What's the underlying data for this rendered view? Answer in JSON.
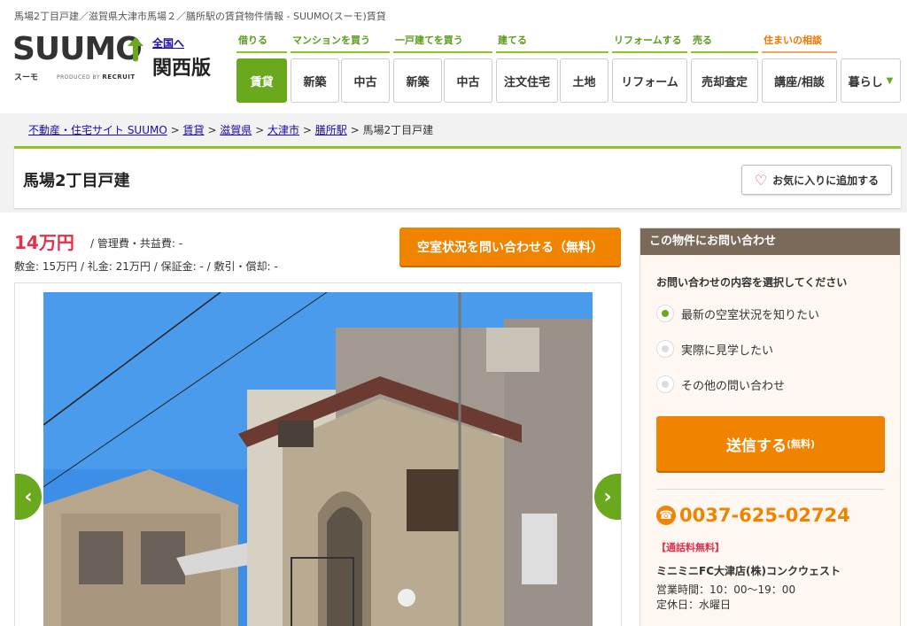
{
  "page_caption": "馬場2丁目戸建／滋賀県大津市馬場２／膳所駅の賃貸物件情報 - SUUMO(スーモ)賃貸",
  "logo": {
    "word": "SUUMO",
    "sub": "スーモ",
    "produced": "PRODUCED BY",
    "recruit": "RECRUIT"
  },
  "region": {
    "link": "全国へ",
    "name": "関西版"
  },
  "nav": {
    "groups": [
      {
        "category": "借りる",
        "buttons": [
          "賃貸"
        ]
      },
      {
        "category": "マンションを買う",
        "buttons": [
          "新築",
          "中古"
        ]
      },
      {
        "category": "一戸建てを買う",
        "buttons": [
          "新築",
          "中古"
        ]
      },
      {
        "category": "建てる",
        "buttons": [
          "注文住宅",
          "土地"
        ]
      },
      {
        "category": "リフォームする",
        "buttons": [
          "リフォーム"
        ]
      },
      {
        "category": "売る",
        "buttons": [
          "売却査定"
        ]
      },
      {
        "category": "住まいの相談",
        "buttons": [
          "講座/相談"
        ]
      },
      {
        "category": "",
        "buttons": [
          "暮らし"
        ]
      }
    ],
    "active": "賃貸",
    "more_icon": "triangle-down"
  },
  "breadcrumb": {
    "items": [
      "不動産・住宅サイト SUUMO",
      "賃貸",
      "滋賀県",
      "大津市",
      "膳所駅"
    ],
    "current": "馬場2丁目戸建",
    "sep": ">"
  },
  "property": {
    "title": "馬場2丁目戸建",
    "favorite_label": "お気に入りに追加する",
    "price": "14万円",
    "price_sub": "/ 管理費・共益費: -",
    "fees": "敷金: 15万円 / 礼金: 21万円 / 保証金: - / 敷引・償却: -",
    "inquire_button": "空室状況を問い合わせる（無料）"
  },
  "gallery": {
    "prev": "‹",
    "next": "›"
  },
  "inquiry": {
    "header": "この物件にお問い合わせ",
    "question": "お問い合わせの内容を選択してください",
    "options": [
      "最新の空室状況を知りたい",
      "実際に見学したい",
      "その他の問い合わせ"
    ],
    "selected_index": 0,
    "send_label": "送信する",
    "send_note": "(無料)",
    "phone": "0037-625-02724",
    "free_call": "【通話料無料】",
    "shop": "ミニミニFC大津店(株)コンクウェスト",
    "hours": "営業時間：10：00〜19：00",
    "holiday": "定休日：水曜日"
  },
  "colors": {
    "brand_green": "#6aa91e",
    "accent_orange": "#f08300",
    "price_red": "#e4304b"
  }
}
